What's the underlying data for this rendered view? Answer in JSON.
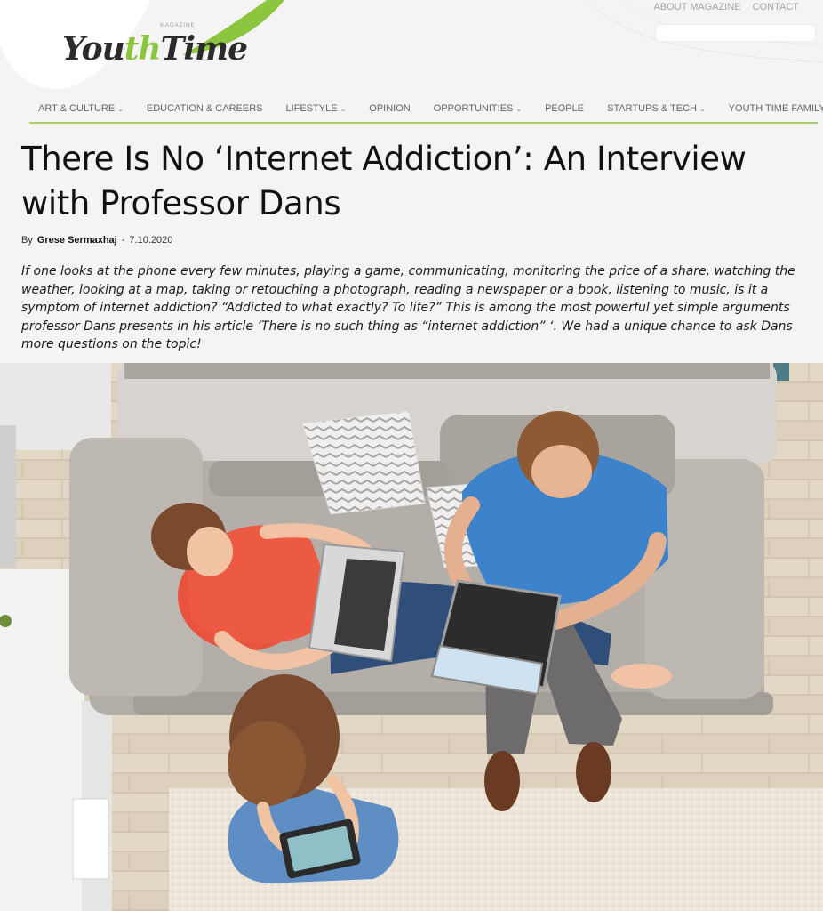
{
  "header": {
    "logo": {
      "part1": "You",
      "accent": "th",
      "part2": "Time",
      "tagline": "MAGAZINE"
    },
    "top_links": [
      "ABOUT MAGAZINE",
      "CONTACT"
    ],
    "search": {
      "value": "",
      "placeholder": ""
    },
    "accent_color": "#8cc63f"
  },
  "nav": {
    "items": [
      {
        "label": "ART & CULTURE",
        "dropdown": true
      },
      {
        "label": "EDUCATION & CAREERS",
        "dropdown": false
      },
      {
        "label": "LIFESTYLE",
        "dropdown": true
      },
      {
        "label": "OPINION",
        "dropdown": false
      },
      {
        "label": "OPPORTUNITIES",
        "dropdown": true
      },
      {
        "label": "PEOPLE",
        "dropdown": false
      },
      {
        "label": "STARTUPS & TECH",
        "dropdown": true
      },
      {
        "label": "YOUTH TIME FAMILY",
        "dropdown": false
      }
    ],
    "chevron": "⌄"
  },
  "article": {
    "title_line1": "There Is No ‘Internet Addiction’: An Interview",
    "title_line2": "with Professor Dans",
    "by": "By",
    "author": "Grese Sermaxhaj",
    "separator": "-",
    "date": "7.10.2020",
    "lede": "If one looks at the phone every few minutes, playing a game, communicating, monitoring the price of a share, watching the weather, looking at a map, taking or retouching a photograph, reading a newspaper or a book, listening to music, is it a symptom of internet addiction? “Addicted to what exactly? To life?” This is among the most powerful yet simple arguments professor Dans presents in his article ‘There is no such thing as “internet addiction” ‘. We had a unique chance to ask Dans more questions on the topic!"
  },
  "hero": {
    "icon": "family-on-sofa-photo",
    "floor_color": "#d9cbb7",
    "sofa_color": "#b8b2ab"
  }
}
